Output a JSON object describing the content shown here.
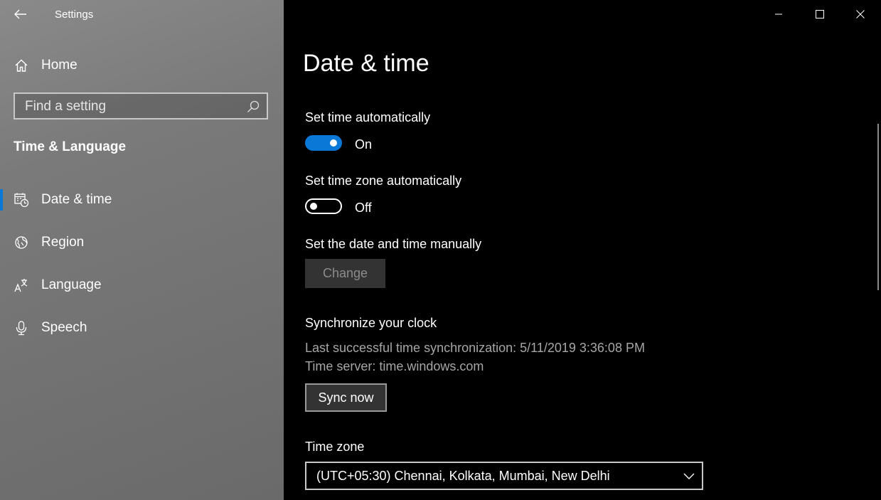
{
  "window": {
    "app_title": "Settings"
  },
  "sidebar": {
    "home_label": "Home",
    "search": {
      "placeholder": "Find a setting"
    },
    "section_title": "Time & Language",
    "items": [
      {
        "label": "Date & time",
        "icon": "calendar-clock-icon",
        "selected": true
      },
      {
        "label": "Region",
        "icon": "globe-icon",
        "selected": false
      },
      {
        "label": "Language",
        "icon": "language-icon",
        "selected": false
      },
      {
        "label": "Speech",
        "icon": "microphone-icon",
        "selected": false
      }
    ]
  },
  "main": {
    "title": "Date & time",
    "set_time_auto": {
      "label": "Set time automatically",
      "state": "On",
      "on": true
    },
    "set_tz_auto": {
      "label": "Set time zone automatically",
      "state": "Off",
      "on": false
    },
    "manual": {
      "label": "Set the date and time manually",
      "button": "Change"
    },
    "sync": {
      "heading": "Synchronize your clock",
      "last_sync_label": "Last successful time synchronization:",
      "last_sync_value": "5/11/2019 3:36:08 PM",
      "server_label": "Time server:",
      "server_value": "time.windows.com",
      "button": "Sync now"
    },
    "time_zone": {
      "label": "Time zone",
      "value": "(UTC+05:30) Chennai, Kolkata, Mumbai, New Delhi"
    }
  },
  "colors": {
    "accent": "#0a78d7",
    "background": "#000000"
  }
}
